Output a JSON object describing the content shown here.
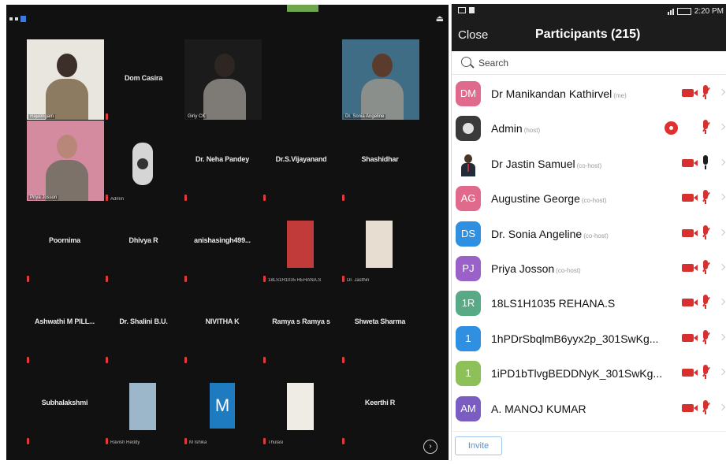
{
  "gallery": {
    "tiles": [
      {
        "name": "",
        "label": "Rajalingam",
        "video": true
      },
      {
        "name": "Dom Casira",
        "label": ""
      },
      {
        "name": "",
        "label": "Giriy CK",
        "video": true
      },
      {
        "name": "",
        "label": "Dr. Sonia Angeline",
        "video": true
      },
      {
        "name": "",
        "label": "Priya Josson",
        "video": true
      },
      {
        "name": "",
        "label": "Admin"
      },
      {
        "name": "Dr. Neha Pandey",
        "label": ""
      },
      {
        "name": "Dr.S.Vijayanand",
        "label": ""
      },
      {
        "name": "Shashidhar",
        "label": ""
      },
      {
        "name": "Poornima",
        "label": ""
      },
      {
        "name": "Dhivya R",
        "label": ""
      },
      {
        "name": "anishasingh499...",
        "label": ""
      },
      {
        "name": "",
        "label": "18LS1H1035 REHANA.S"
      },
      {
        "name": "",
        "label": "Dr. Jasthin"
      },
      {
        "name": "Ashwathi M PILL...",
        "label": ""
      },
      {
        "name": "Dr. Shalini B.U.",
        "label": ""
      },
      {
        "name": "NIVITHA K",
        "label": ""
      },
      {
        "name": "Ramya s Ramya s",
        "label": ""
      },
      {
        "name": "Shweta Sharma",
        "label": ""
      },
      {
        "name": "Subhalakshmi",
        "label": ""
      },
      {
        "name": "",
        "label": "Ravish Reddy"
      },
      {
        "name": "",
        "label": "M Ishika"
      },
      {
        "name": "",
        "label": "Thulasi"
      },
      {
        "name": "Keerthi R",
        "label": ""
      }
    ],
    "m_avatar_letter": "M",
    "more_label": "›"
  },
  "panel": {
    "status": {
      "time": "2:20 PM"
    },
    "close_label": "Close",
    "title": "Participants (215)",
    "search_placeholder": "Search",
    "participants": [
      {
        "initials": "DM",
        "name": "Dr Manikandan Kathirvel",
        "role": "(me)",
        "avatar_color": "#e06a8c",
        "avatar_type": "initials",
        "video_off": true,
        "mic": "muted"
      },
      {
        "initials": "",
        "name": "Admin",
        "role": "(host)",
        "avatar_color": "#3a3a3a",
        "avatar_type": "logo",
        "video_off": false,
        "recording": true,
        "mic": "muted"
      },
      {
        "initials": "",
        "name": "Dr Jastin Samuel",
        "role": "(co-host)",
        "avatar_color": "#ffffff",
        "avatar_type": "photo",
        "video_off": true,
        "mic": "live"
      },
      {
        "initials": "AG",
        "name": "Augustine George",
        "role": "(co-host)",
        "avatar_color": "#e06a8c",
        "avatar_type": "initials",
        "video_off": true,
        "mic": "muted"
      },
      {
        "initials": "DS",
        "name": "Dr. Sonia Angeline",
        "role": "(co-host)",
        "avatar_color": "#2f8fe0",
        "avatar_type": "initials",
        "video_off": true,
        "mic": "muted"
      },
      {
        "initials": "PJ",
        "name": "Priya Josson",
        "role": "(co-host)",
        "avatar_color": "#9a62c8",
        "avatar_type": "initials",
        "video_off": true,
        "mic": "muted"
      },
      {
        "initials": "1R",
        "name": "18LS1H1035 REHANA.S",
        "role": "",
        "avatar_color": "#58a986",
        "avatar_type": "initials",
        "video_off": true,
        "mic": "muted"
      },
      {
        "initials": "1",
        "name": "1hPDrSbqlmB6yyx2p_301SwKg...",
        "role": "",
        "avatar_color": "#2f8fe0",
        "avatar_type": "initials",
        "video_off": true,
        "mic": "muted"
      },
      {
        "initials": "1",
        "name": "1iPD1bTlvgBEDDNyK_301SwKg...",
        "role": "",
        "avatar_color": "#8ec05a",
        "avatar_type": "initials",
        "video_off": true,
        "mic": "muted"
      },
      {
        "initials": "AM",
        "name": "A. MANOJ KUMAR",
        "role": "",
        "avatar_color": "#7a5cc2",
        "avatar_type": "initials",
        "video_off": true,
        "mic": "muted"
      }
    ],
    "invite_label": "Invite"
  }
}
